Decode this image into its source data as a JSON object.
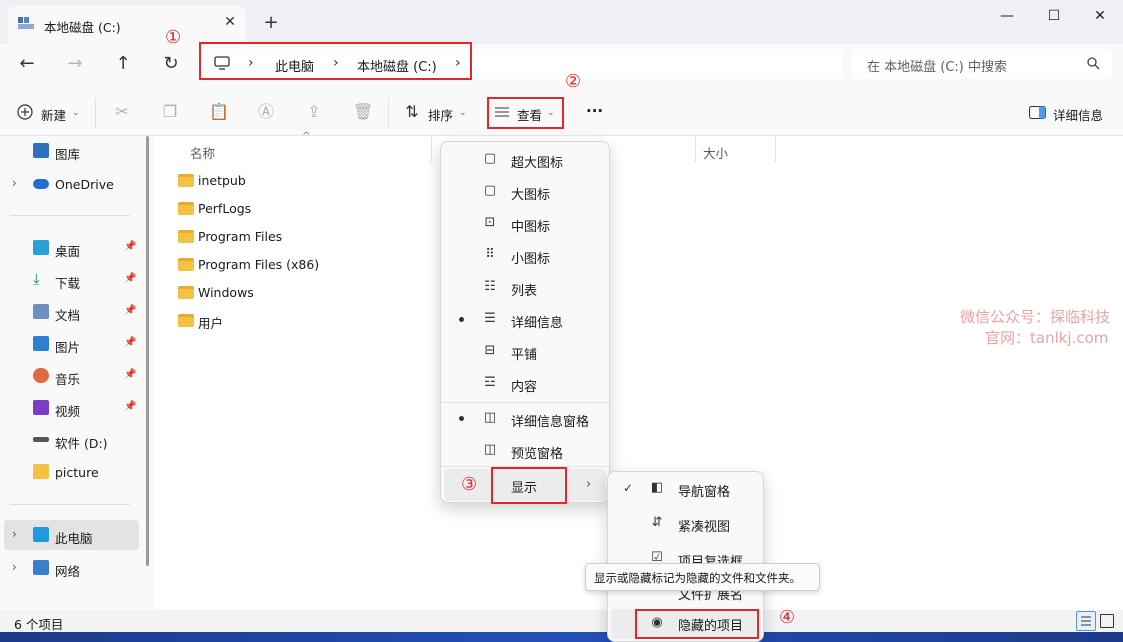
{
  "window": {
    "tab_title": "本地磁盘 (C:)",
    "tab_close_glyph": "✕",
    "new_tab_glyph": "+",
    "minimize_glyph": "—",
    "maximize_glyph": "☐",
    "close_glyph": "✕"
  },
  "nav": {
    "back_glyph": "←",
    "forward_glyph": "→",
    "up_glyph": "↑",
    "refresh_glyph": "↻"
  },
  "address": {
    "crumbs": [
      "此电脑",
      "本地磁盘 (C:)"
    ],
    "separator": "›"
  },
  "search": {
    "placeholder": "在 本地磁盘 (C:) 中搜索"
  },
  "toolbar": {
    "new_label": "新建",
    "sort_label": "排序",
    "view_label": "查看",
    "more_label": "···",
    "details_label": "详细信息"
  },
  "sidebar": {
    "items": [
      {
        "label": "图库",
        "icon": "gallery-icon"
      },
      {
        "label": "OneDrive",
        "icon": "cloud-icon"
      },
      {
        "label": "桌面",
        "icon": "desktop-icon"
      },
      {
        "label": "下载",
        "icon": "download-icon"
      },
      {
        "label": "文档",
        "icon": "document-icon"
      },
      {
        "label": "图片",
        "icon": "picture-icon"
      },
      {
        "label": "音乐",
        "icon": "music-icon"
      },
      {
        "label": "视频",
        "icon": "video-icon"
      },
      {
        "label": "软件 (D:)",
        "icon": "drive-icon"
      },
      {
        "label": "picture",
        "icon": "folder-icon"
      },
      {
        "label": "此电脑",
        "icon": "pc-icon"
      },
      {
        "label": "网络",
        "icon": "network-icon"
      }
    ]
  },
  "content": {
    "columns": {
      "name": "名称",
      "size": "大小"
    },
    "files": [
      "inetpub",
      "PerfLogs",
      "Program Files",
      "Program Files (x86)",
      "Windows",
      "用户"
    ]
  },
  "view_menu": {
    "items": [
      "超大图标",
      "大图标",
      "中图标",
      "小图标",
      "列表",
      "详细信息",
      "平铺",
      "内容",
      "详细信息窗格",
      "预览窗格",
      "显示"
    ]
  },
  "show_menu": {
    "items": [
      "导航窗格",
      "紧凑视图",
      "项目复选框",
      "文件扩展名",
      "隐藏的项目"
    ]
  },
  "tooltip": {
    "text": "显示或隐藏标记为隐藏的文件和文件夹。"
  },
  "status": {
    "items_count": "6 个项目"
  },
  "watermark": {
    "line1": "微信公众号：探临科技",
    "line2": "官网：tanlkj.com"
  },
  "markers": [
    "①",
    "②",
    "③",
    "④"
  ],
  "colors": {
    "highlight_red": "#e0282a",
    "folder_yellow": "#f4c242",
    "accent_blue": "#0067c0"
  }
}
